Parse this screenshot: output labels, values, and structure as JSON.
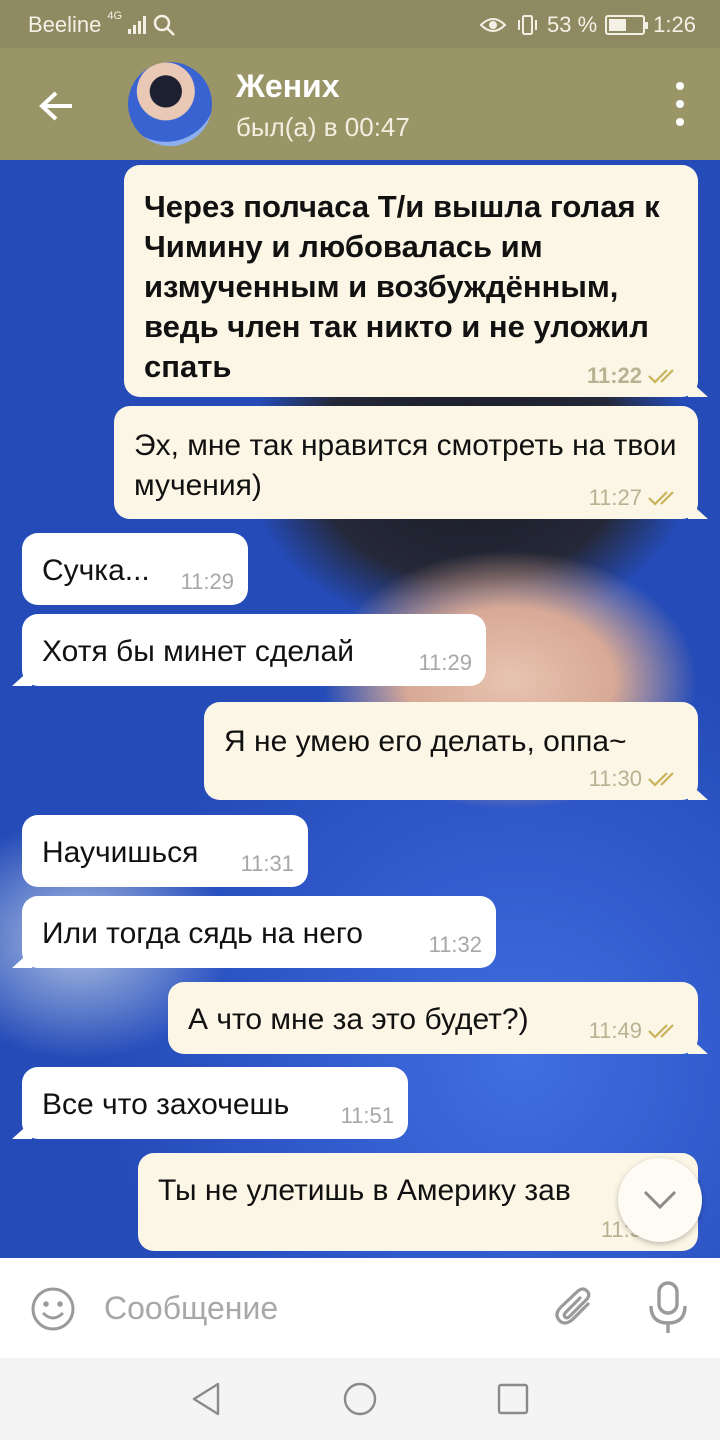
{
  "status_bar": {
    "carrier": "Beeline",
    "network": "4G",
    "battery_percent": "53 %",
    "battery_level": 0.53,
    "time": "1:26"
  },
  "header": {
    "back_icon": "arrow-left-icon",
    "chat_name": "Жених",
    "last_seen": "был(а) в 00:47",
    "menu_icon": "more-vertical-icon"
  },
  "messages": [
    {
      "direction": "out",
      "text": "Через полчаса Т/и вышла голая к Чимину и любовалась им измученным и возбуждённым, ведь член так никто и не уложил спать",
      "time": "11:22",
      "read": true
    },
    {
      "direction": "out",
      "text": "Эх, мне так нравится смотреть на твои мучения)",
      "time": "11:27",
      "read": true
    },
    {
      "direction": "in",
      "text": "Сучка...",
      "time": "11:29"
    },
    {
      "direction": "in",
      "text": "Хотя бы минет сделай",
      "time": "11:29"
    },
    {
      "direction": "out",
      "text": "Я не умею его делать, оппа~",
      "time": "11:30",
      "read": true
    },
    {
      "direction": "in",
      "text": "Научишься",
      "time": "11:31"
    },
    {
      "direction": "in",
      "text": "Или тогда сядь на него",
      "time": "11:32"
    },
    {
      "direction": "out",
      "text": "А что мне за это будет?)",
      "time": "11:49",
      "read": true
    },
    {
      "direction": "in",
      "text": "Все что захочешь",
      "time": "11:51"
    },
    {
      "direction": "out",
      "text": "Ты не улетишь в Америку зав",
      "time": "11:5",
      "read": false
    }
  ],
  "input": {
    "placeholder": "Сообщение",
    "emoji_icon": "emoji-icon",
    "attach_icon": "paperclip-icon",
    "mic_icon": "microphone-icon"
  },
  "navigation": {
    "back_icon": "nav-back-icon",
    "home_icon": "nav-home-icon",
    "recents_icon": "nav-recents-icon"
  },
  "colors": {
    "header": "#9a9567",
    "status_bar": "#8f8a62",
    "outgoing_bubble": "#fbf6e5",
    "incoming_bubble": "#ffffff",
    "read_tick": "#c9b35a"
  }
}
